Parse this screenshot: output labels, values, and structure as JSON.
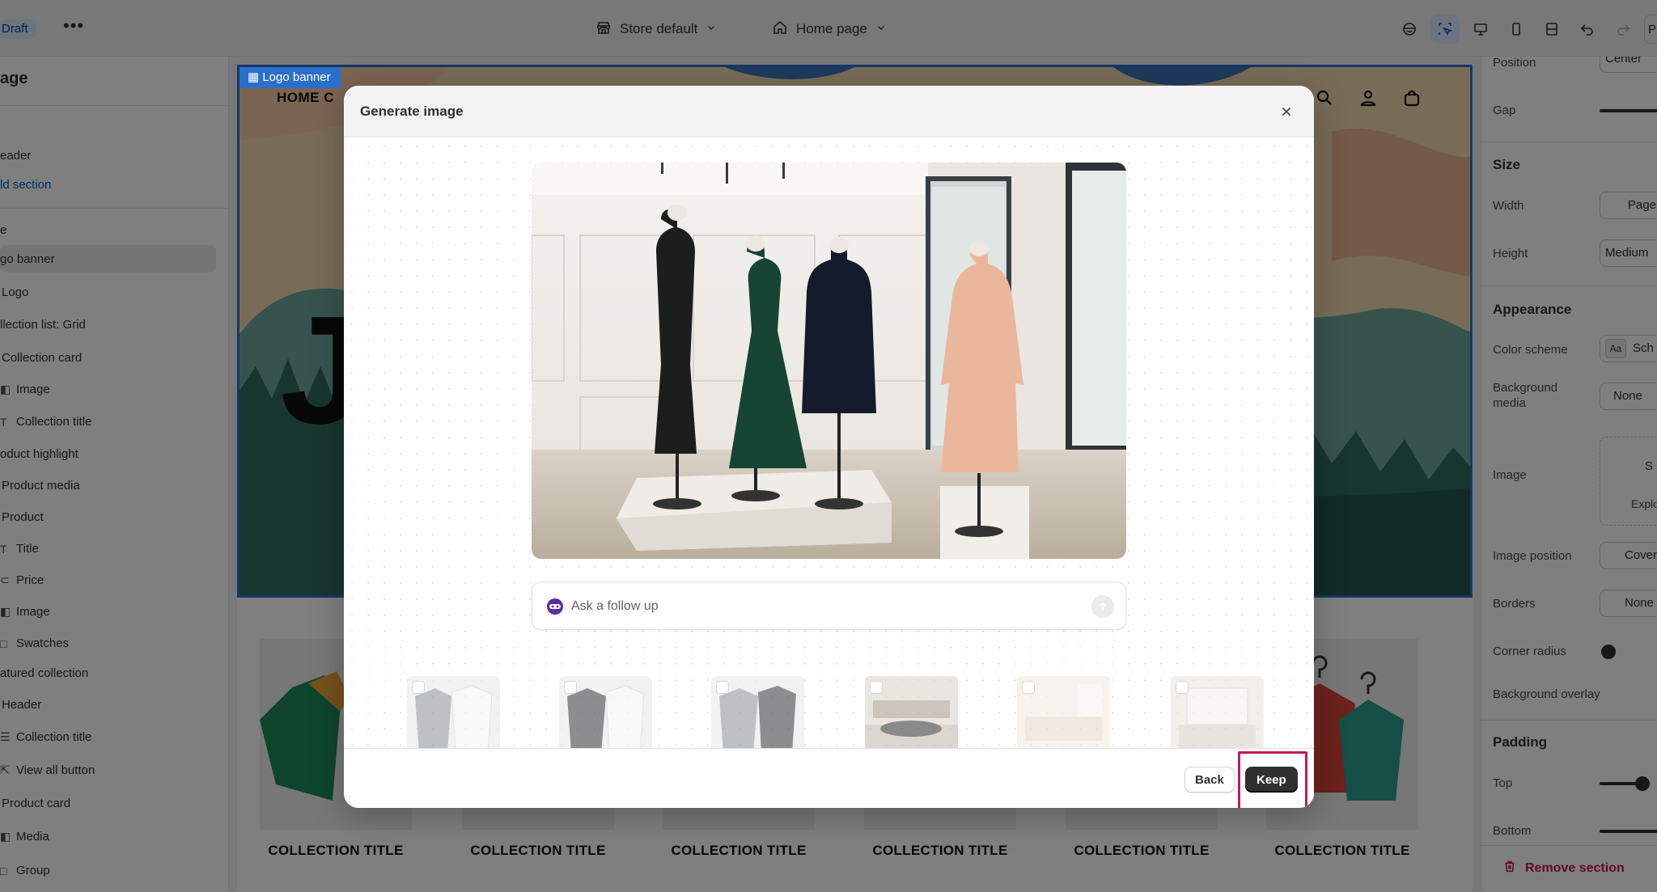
{
  "topbar": {
    "draft_label": "Draft",
    "more_label": "•••",
    "store_select": "Store default",
    "page_select": "Home page",
    "cut_label": "P"
  },
  "left_sidebar": {
    "title": "age",
    "items": [
      {
        "label": "eader",
        "icon": ""
      },
      {
        "label": "ld section",
        "icon": ""
      },
      {
        "label": "e",
        "icon": ""
      },
      {
        "label": "go banner",
        "icon": ""
      },
      {
        "label": "Logo",
        "icon": ""
      },
      {
        "label": "llection list: Grid",
        "icon": ""
      },
      {
        "label": "Collection card",
        "icon": ""
      },
      {
        "label": "Image",
        "icon": "image-icon"
      },
      {
        "label": "Collection title",
        "icon": "text-icon"
      },
      {
        "label": "oduct highlight",
        "icon": ""
      },
      {
        "label": "Product media",
        "icon": ""
      },
      {
        "label": "Product",
        "icon": ""
      },
      {
        "label": "Title",
        "icon": "text-icon"
      },
      {
        "label": "Price",
        "icon": "price-icon"
      },
      {
        "label": "Image",
        "icon": "image-icon"
      },
      {
        "label": "Swatches",
        "icon": "swatch-icon"
      },
      {
        "label": "atured collection",
        "icon": ""
      },
      {
        "label": "Header",
        "icon": ""
      },
      {
        "label": "Collection title",
        "icon": "text-icon"
      },
      {
        "label": "View all button",
        "icon": "button-icon"
      },
      {
        "label": "Product card",
        "icon": ""
      },
      {
        "label": "Media",
        "icon": "image-icon"
      },
      {
        "label": "Group",
        "icon": "group-icon"
      }
    ]
  },
  "preview": {
    "banner_label": "Logo banner",
    "nav_text": "HOME    C",
    "big_letter": "J",
    "collection_titles": [
      "COLLECTION TITLE",
      "COLLECTION TITLE",
      "COLLECTION TITLE",
      "COLLECTION TITLE",
      "COLLECTION TITLE",
      "COLLECTION TITLE"
    ]
  },
  "right_panel": {
    "position_label": "Position",
    "position_value": "Center",
    "gap_label": "Gap",
    "size_heading": "Size",
    "width_label": "Width",
    "width_value": "Page",
    "height_label": "Height",
    "height_value": "Medium",
    "appearance_heading": "Appearance",
    "color_scheme_label": "Color scheme",
    "color_scheme_value": "Sch",
    "color_scheme_swatch": "Aa",
    "background_media_label": "Background media",
    "background_media_value": "None",
    "image_label": "Image",
    "image_select": "S",
    "image_explore": "Explo",
    "image_position_label": "Image position",
    "image_position_value": "Cover",
    "borders_label": "Borders",
    "borders_value": "None",
    "corner_radius_label": "Corner radius",
    "background_overlay_label": "Background overlay",
    "padding_heading": "Padding",
    "top_label": "Top",
    "bottom_label": "Bottom",
    "remove_section": "Remove section"
  },
  "modal": {
    "title": "Generate image",
    "followup_placeholder": "Ask a follow up",
    "back_label": "Back",
    "keep_label": "Keep"
  },
  "colors": {
    "accent_blue": "#2c6ecb",
    "keep_button": "#303030",
    "highlight": "#c2185b",
    "remove": "#c91a44"
  }
}
